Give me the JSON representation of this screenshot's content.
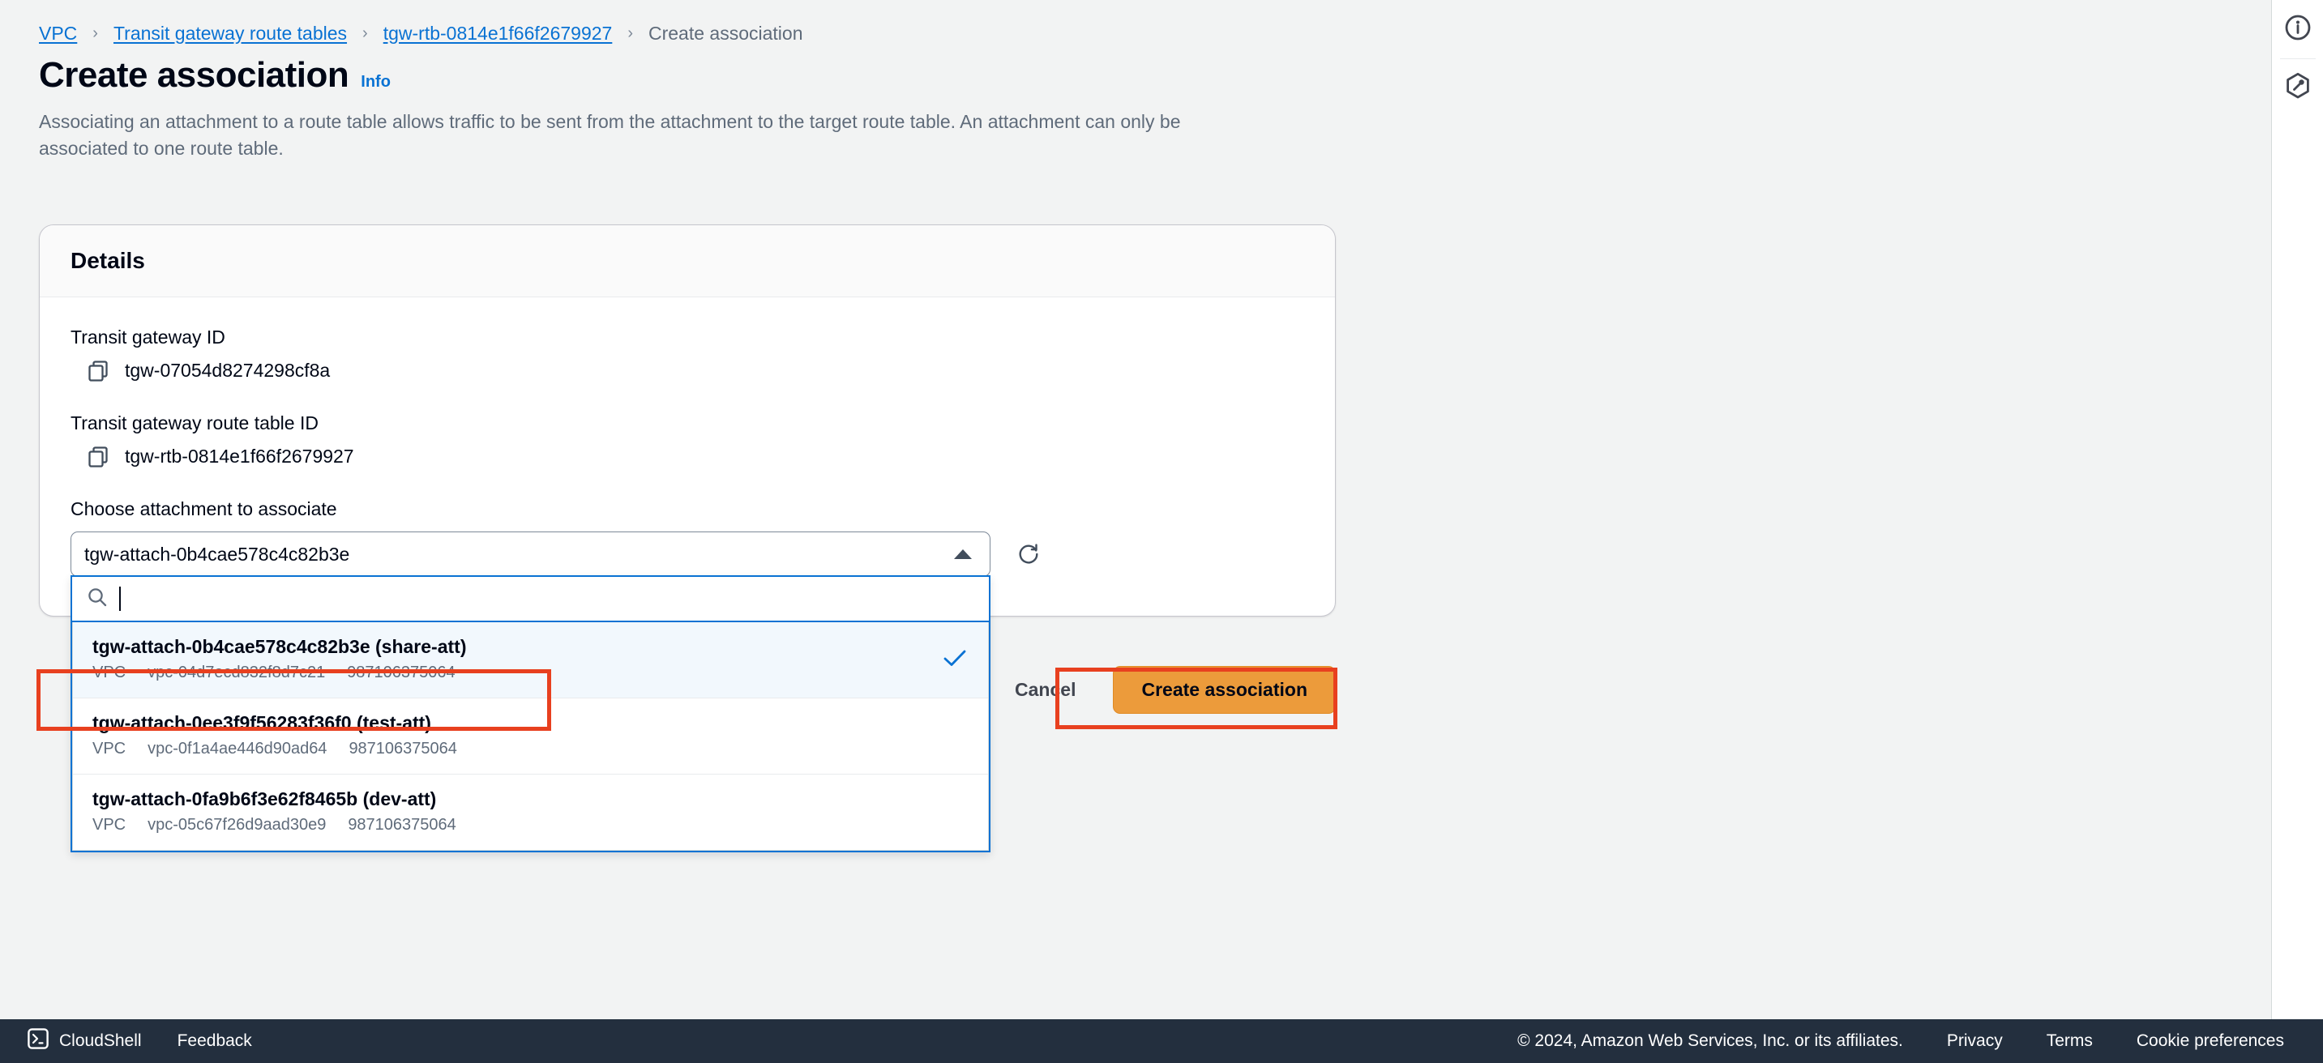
{
  "breadcrumb": {
    "items": [
      {
        "label": "VPC",
        "type": "link"
      },
      {
        "label": "Transit gateway route tables",
        "type": "link"
      },
      {
        "label": "tgw-rtb-0814e1f66f2679927",
        "type": "link"
      },
      {
        "label": "Create association",
        "type": "current"
      }
    ],
    "separator": "›"
  },
  "page": {
    "title": "Create association",
    "info_label": "Info",
    "description": "Associating an attachment to a route table allows traffic to be sent from the attachment to the target route table. An attachment can only be associated to one route table."
  },
  "details": {
    "header": "Details",
    "transit_gateway_id_label": "Transit gateway ID",
    "transit_gateway_id_value": "tgw-07054d8274298cf8a",
    "route_table_id_label": "Transit gateway route table ID",
    "route_table_id_value": "tgw-rtb-0814e1f66f2679927",
    "attachment_label": "Choose attachment to associate",
    "attachment_selected": "tgw-attach-0b4cae578c4c82b3e",
    "copy_icon": "copy-icon",
    "refresh_icon": "refresh-icon",
    "caret_icon": "caret-up-icon"
  },
  "dropdown": {
    "search_placeholder": "",
    "search_value": "",
    "search_icon": "search-icon",
    "check_icon": "check-icon",
    "vpc_label": "VPC",
    "options": [
      {
        "title": "tgw-attach-0b4cae578c4c82b3e (share-att)",
        "type": "VPC",
        "vpc_id": "vpc-04d7ecd832f8d7c21",
        "account": "987106375064",
        "selected": true
      },
      {
        "title": "tgw-attach-0ee3f9f56283f36f0 (test-att)",
        "type": "VPC",
        "vpc_id": "vpc-0f1a4ae446d90ad64",
        "account": "987106375064",
        "selected": false
      },
      {
        "title": "tgw-attach-0fa9b6f3e62f8465b (dev-att)",
        "type": "VPC",
        "vpc_id": "vpc-05c67f26d9aad30e9",
        "account": "987106375064",
        "selected": false
      }
    ]
  },
  "actions": {
    "cancel_label": "Cancel",
    "submit_label": "Create association"
  },
  "right_rail": {
    "info_icon": "info-circle-icon",
    "tools_icon": "hexagon-settings-icon"
  },
  "footer": {
    "cloudshell_label": "CloudShell",
    "cloudshell_icon": "cloudshell-terminal-icon",
    "feedback_label": "Feedback",
    "copyright": "© 2024, Amazon Web Services, Inc. or its affiliates.",
    "privacy_label": "Privacy",
    "terms_label": "Terms",
    "cookie_label": "Cookie preferences"
  },
  "colors": {
    "link": "#0972d3",
    "primary_button": "#ec9b3b",
    "annotation": "#e8401f",
    "footer_bg": "#232f3e",
    "page_bg": "#f2f3f3"
  }
}
